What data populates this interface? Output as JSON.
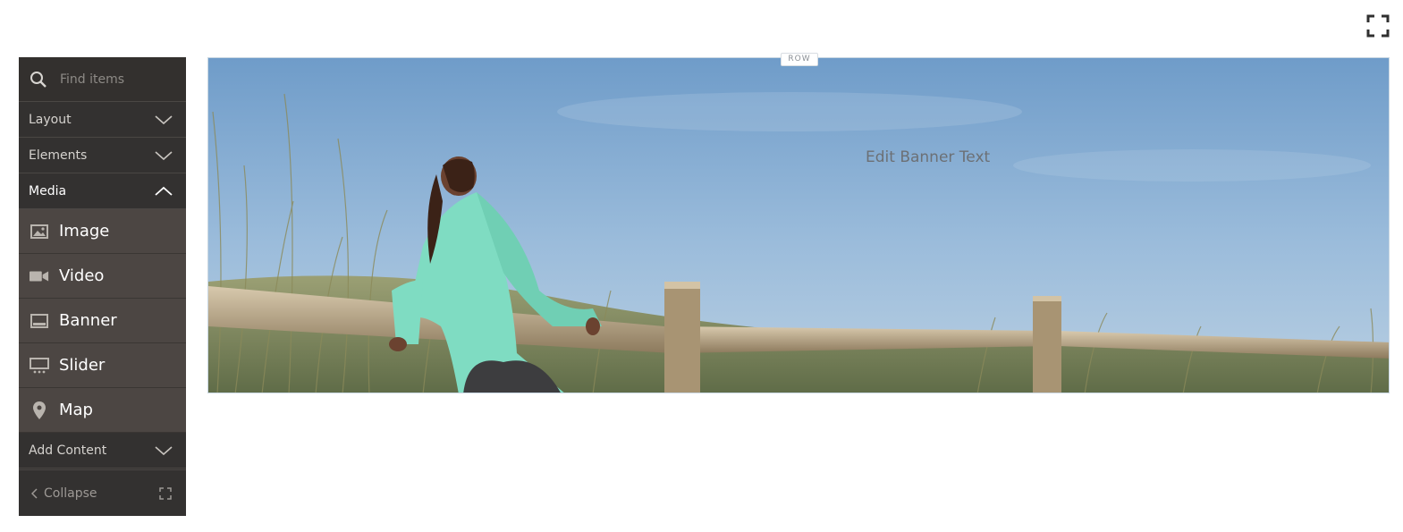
{
  "toolbar": {
    "fullscreen_icon": "expand-icon"
  },
  "panel": {
    "search": {
      "placeholder": "Find items",
      "icon": "search-icon"
    },
    "categories": {
      "layout": "Layout",
      "elements": "Elements",
      "media": "Media",
      "add_content": "Add Content"
    },
    "media_items": [
      {
        "label": "Image",
        "icon": "image-icon"
      },
      {
        "label": "Video",
        "icon": "video-icon"
      },
      {
        "label": "Banner",
        "icon": "banner-icon"
      },
      {
        "label": "Slider",
        "icon": "slider-icon"
      },
      {
        "label": "Map",
        "icon": "map-pin-icon"
      }
    ],
    "collapse_label": "Collapse"
  },
  "stage": {
    "row_tag": "ROW",
    "banner_text": "Edit Banner Text"
  },
  "colors": {
    "panel_bg": "#333130",
    "panel_item_bg": "#4c4643",
    "sky": "#86add3"
  }
}
